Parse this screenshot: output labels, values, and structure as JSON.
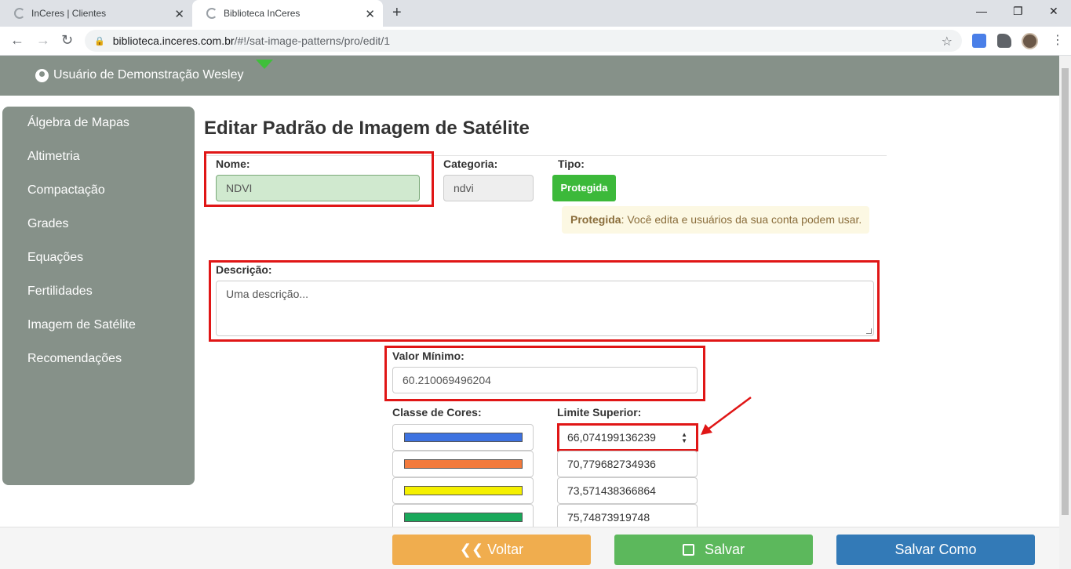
{
  "browser": {
    "tabs": [
      {
        "title": "InCeres | Clientes"
      },
      {
        "title": "Biblioteca InCeres"
      }
    ],
    "url_host": "biblioteca.inceres.com.br",
    "url_path": "/#!/sat-image-patterns/pro/edit/1",
    "icons": [
      "back-icon",
      "forward-icon",
      "reload-icon",
      "lock-icon",
      "star-icon",
      "translate-icon",
      "puzzle-icon",
      "avatar",
      "menu-icon"
    ]
  },
  "header": {
    "user_name": "Usuário de Demonstração Wesley"
  },
  "sidebar": {
    "items": [
      {
        "label": "Álgebra de Mapas"
      },
      {
        "label": "Altimetria"
      },
      {
        "label": "Compactação"
      },
      {
        "label": "Grades"
      },
      {
        "label": "Equações"
      },
      {
        "label": "Fertilidades"
      },
      {
        "label": "Imagem de Satélite"
      },
      {
        "label": "Recomendações"
      }
    ]
  },
  "form": {
    "title": "Editar Padrão de Imagem de Satélite",
    "nome_label": "Nome:",
    "nome_value": "NDVI",
    "categoria_label": "Categoria:",
    "categoria_value": "ndvi",
    "tipo_label": "Tipo:",
    "tipo_button": "Protegida",
    "alert_strong": "Protegida",
    "alert_text": ": Você edita e usuários da sua conta podem usar.",
    "descricao_label": "Descrição:",
    "descricao_placeholder": "Uma descrição...",
    "valor_minimo_label": "Valor Mínimo:",
    "valor_minimo_value": "60.210069496204",
    "classe_cores_label": "Classe de Cores:",
    "limite_superior_label": "Limite Superior:",
    "classes": [
      {
        "color": "#3d72e0",
        "limit": "66,074199136239"
      },
      {
        "color": "#f27a3c",
        "limit": "70,779682734936"
      },
      {
        "color": "#f5f000",
        "limit": "73,571438366864"
      },
      {
        "color": "#19a85a",
        "limit": "75,74873919748"
      }
    ]
  },
  "footer": {
    "voltar": "Voltar",
    "salvar": "Salvar",
    "salvar_como": "Salvar Como"
  },
  "colors": {
    "header_bg": "#869189",
    "highlight_red": "#e01616",
    "tipo_green": "#3cb93a",
    "voltar_orange": "#f0ad4e",
    "salvar_green": "#5cb85c",
    "salvar_como_blue": "#337ab7"
  }
}
